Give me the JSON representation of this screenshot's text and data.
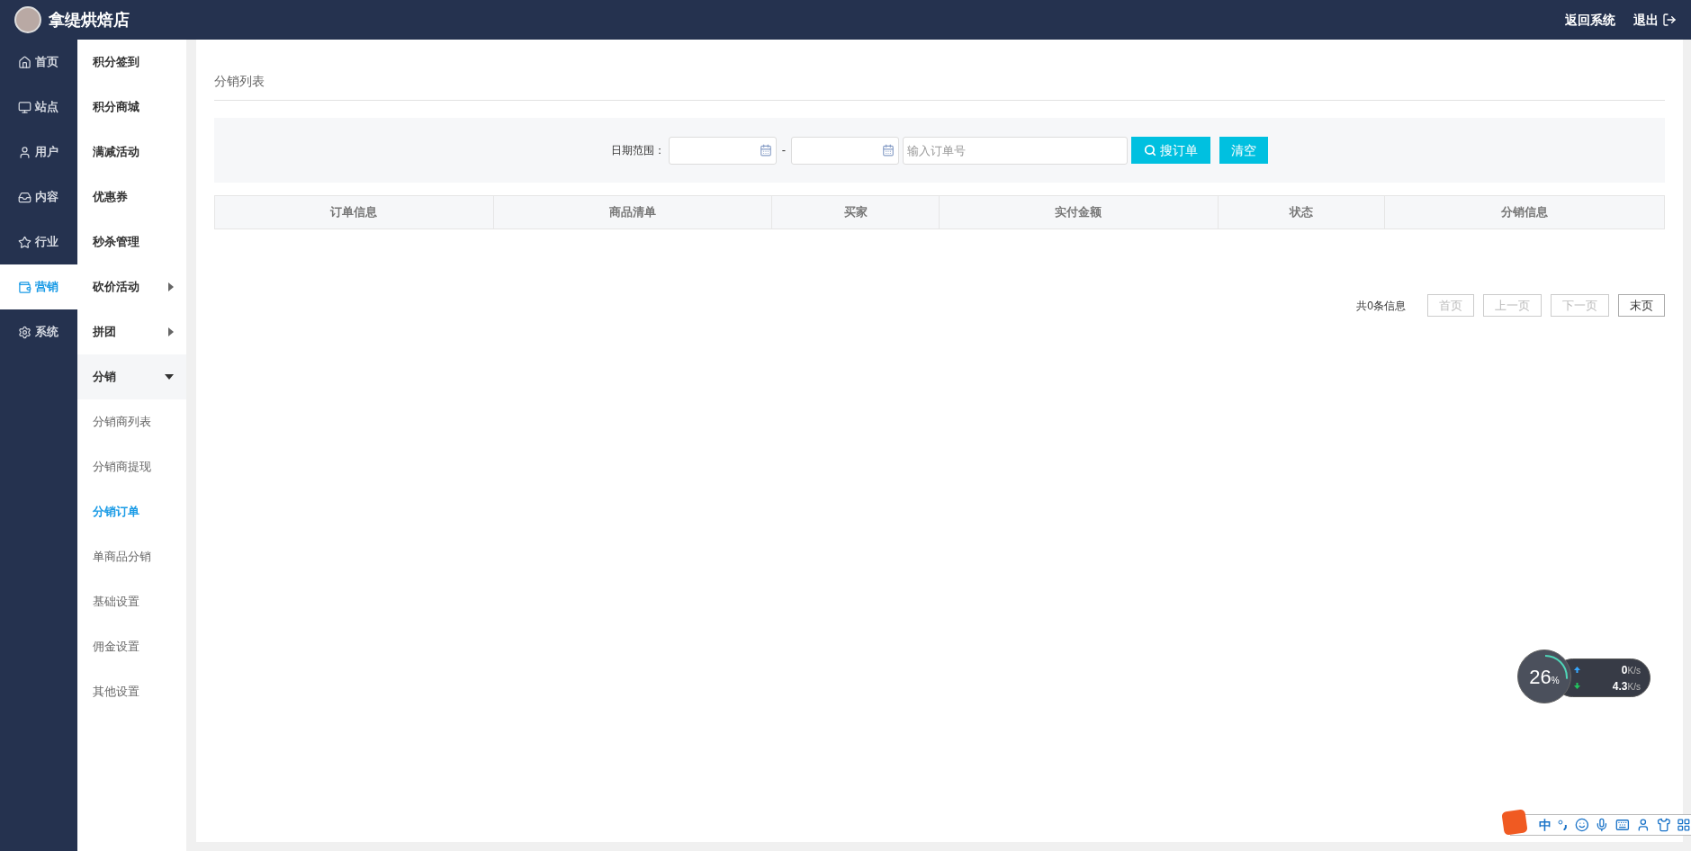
{
  "header": {
    "shop_name": "拿缇烘焙店",
    "actions": [
      "返回系统",
      "退出"
    ]
  },
  "nav": [
    {
      "label": "首页",
      "selected": false
    },
    {
      "label": "站点",
      "selected": false
    },
    {
      "label": "用户",
      "selected": false
    },
    {
      "label": "内容",
      "selected": false
    },
    {
      "label": "行业",
      "selected": false
    },
    {
      "label": "营销",
      "selected": true
    },
    {
      "label": "系统",
      "selected": false
    }
  ],
  "subnav": [
    {
      "label": "积分签到",
      "kind": "link"
    },
    {
      "label": "积分商城",
      "kind": "link"
    },
    {
      "label": "满减活动",
      "kind": "link"
    },
    {
      "label": "优惠券",
      "kind": "link"
    },
    {
      "label": "秒杀管理",
      "kind": "link"
    },
    {
      "label": "砍价活动",
      "kind": "group",
      "expanded": false
    },
    {
      "label": "拼团",
      "kind": "group",
      "expanded": false
    },
    {
      "label": "分销",
      "kind": "group",
      "expanded": true,
      "children": [
        {
          "label": "分销商列表",
          "selected": false
        },
        {
          "label": "分销商提现",
          "selected": false
        },
        {
          "label": "分销订单",
          "selected": true
        },
        {
          "label": "单商品分销",
          "selected": false
        },
        {
          "label": "基础设置",
          "selected": false
        },
        {
          "label": "佣金设置",
          "selected": false
        },
        {
          "label": "其他设置",
          "selected": false
        }
      ]
    }
  ],
  "page": {
    "title": "分销列表",
    "filter": {
      "date_label": "日期范围：",
      "separator": "-",
      "order_placeholder": "输入订单号",
      "search_button": "搜订单",
      "clear_button": "清空"
    },
    "table": {
      "columns": [
        "订单信息",
        "商品清单",
        "买家",
        "实付金额",
        "状态",
        "分销信息"
      ]
    },
    "pagination": {
      "summary": "共0条信息",
      "buttons": [
        {
          "label": "首页",
          "disabled": true
        },
        {
          "label": "上一页",
          "disabled": true
        },
        {
          "label": "下一页",
          "disabled": true
        },
        {
          "label": "末页",
          "disabled": false
        }
      ]
    }
  },
  "net_monitor": {
    "percent": "26",
    "unit": "%",
    "upload": "0",
    "upload_unit": "K/s",
    "download": "4.3",
    "download_unit": "K/s"
  },
  "ime_bar": {
    "mode": "中"
  }
}
